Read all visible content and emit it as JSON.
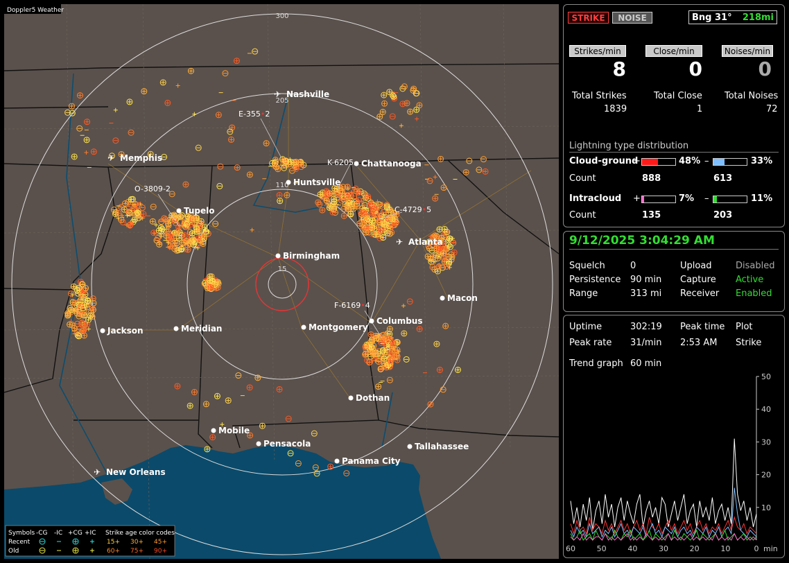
{
  "map": {
    "title": "Doppler5 Weather",
    "range_labels": [
      "300",
      "205",
      "110",
      "15"
    ],
    "cities": [
      {
        "name": "Nashville",
        "airport": true
      },
      {
        "name": "Memphis",
        "airport": true
      },
      {
        "name": "Chattanooga",
        "airport": false
      },
      {
        "name": "Huntsville",
        "airport": false
      },
      {
        "name": "Tupelo",
        "airport": false
      },
      {
        "name": "Atlanta",
        "airport": true
      },
      {
        "name": "Birmingham",
        "airport": false
      },
      {
        "name": "Macon",
        "airport": false
      },
      {
        "name": "Columbus",
        "airport": false
      },
      {
        "name": "Montgomery",
        "airport": false
      },
      {
        "name": "Meridian",
        "airport": false
      },
      {
        "name": "Jackson",
        "airport": false
      },
      {
        "name": "Dothan",
        "airport": false
      },
      {
        "name": "Mobile",
        "airport": false
      },
      {
        "name": "Pensacola",
        "airport": false
      },
      {
        "name": "Tallahassee",
        "airport": false
      },
      {
        "name": "Panama City",
        "airport": false
      },
      {
        "name": "New Orleans",
        "airport": true
      }
    ],
    "cells": [
      "E-355",
      "2",
      "K-6205",
      "O-3809",
      "2",
      "C-4729",
      "5",
      "F-6169",
      "4"
    ],
    "legend": {
      "symbols_label": "Symbols",
      "headers": [
        "-CG",
        "-IC",
        "+CG",
        "+IC"
      ],
      "rows": [
        "Recent",
        "Old"
      ],
      "age_title": "Strike age color codes",
      "ages_recent": [
        "15+",
        "30+",
        "45+"
      ],
      "ages_old": [
        "60+",
        "75+",
        "90+"
      ]
    },
    "colors": {
      "water": "#0d4d6e",
      "land": "#5a514c",
      "gulf": "#0b3d5c"
    }
  },
  "status": {
    "strike_label": "STRIKE",
    "noise_label": "NOISE",
    "bearing": "Bng 31°",
    "distance": "218mi"
  },
  "rates": {
    "strikes_label": "Strikes/min",
    "close_label": "Close/min",
    "noises_label": "Noises/min",
    "strikes_value": "8",
    "close_value": "0",
    "noises_value": "0"
  },
  "totals": {
    "strikes_label": "Total Strikes",
    "close_label": "Total Close",
    "noises_label": "Total Noises",
    "strikes": "1839",
    "close": "1",
    "noises": "72"
  },
  "distribution": {
    "title": "Lightning type distribution",
    "cg_label": "Cloud-ground",
    "ic_label": "Intracloud",
    "count_label": "Count",
    "plus": "+",
    "minus": "–",
    "cg_pos_pct": "48%",
    "cg_neg_pct": "33%",
    "ic_pos_pct": "7%",
    "ic_neg_pct": "11%",
    "cg_pos_frac": 0.48,
    "cg_neg_frac": 0.33,
    "ic_pos_frac": 0.07,
    "ic_neg_frac": 0.11,
    "cg_pos_count": "888",
    "cg_neg_count": "613",
    "ic_pos_count": "135",
    "ic_neg_count": "203",
    "colors": {
      "cg_pos": "#ff1a1a",
      "cg_neg": "#7fbfff",
      "ic_pos": "#ff66cc",
      "ic_neg": "#33dd33"
    }
  },
  "settings": {
    "datetime": "9/12/2025 3:04:29 AM",
    "squelch_label": "Squelch",
    "squelch": "0",
    "persistence_label": "Persistence",
    "persistence": "90 min",
    "range_label": "Range",
    "range": "313 mi",
    "upload_label": "Upload",
    "upload": "Disabled",
    "capture_label": "Capture",
    "capture": "Active",
    "receiver_label": "Receiver",
    "receiver": "Enabled"
  },
  "stats": {
    "uptime_label": "Uptime",
    "uptime": "302:19",
    "peak_time_label": "Peak time",
    "peak_time": "2:53 AM",
    "plot_label": "Plot",
    "plot": "Strike",
    "peak_rate_label": "Peak rate",
    "peak_rate": "31/min",
    "trend_label": "Trend graph",
    "trend": "60 min"
  },
  "chart_data": {
    "type": "line",
    "xlabel": "min",
    "x_ticks": [
      "60",
      "50",
      "40",
      "30",
      "20",
      "10",
      "0"
    ],
    "y_ticks": [
      "50",
      "40",
      "30",
      "20",
      "10"
    ],
    "xlim": [
      60,
      0
    ],
    "ylim": [
      0,
      50
    ],
    "series": [
      {
        "color": "#ffffff",
        "values": [
          12,
          5,
          10,
          4,
          11,
          6,
          13,
          3,
          9,
          12,
          5,
          14,
          7,
          11,
          4,
          10,
          13,
          6,
          12,
          8,
          5,
          11,
          14,
          4,
          9,
          12,
          7,
          10,
          5,
          13,
          11,
          4,
          8,
          12,
          6,
          10,
          14,
          5,
          9,
          11,
          4,
          12,
          7,
          10,
          6,
          13,
          5,
          9,
          11,
          6,
          10,
          5,
          31,
          14,
          9,
          12,
          6,
          10,
          4,
          8
        ]
      },
      {
        "color": "#ff3333",
        "values": [
          5,
          2,
          6,
          3,
          4,
          2,
          7,
          3,
          5,
          4,
          2,
          6,
          3,
          5,
          2,
          4,
          6,
          3,
          5,
          2,
          4,
          6,
          3,
          5,
          2,
          7,
          4,
          3,
          5,
          2,
          4,
          6,
          3,
          5,
          2,
          4,
          6,
          3,
          5,
          2,
          4,
          6,
          3,
          5,
          2,
          4,
          3,
          5,
          2,
          4,
          6,
          3,
          7,
          4,
          3,
          5,
          2,
          4,
          3,
          2
        ]
      },
      {
        "color": "#7fbfff",
        "values": [
          3,
          1,
          4,
          2,
          3,
          1,
          5,
          2,
          3,
          4,
          1,
          3,
          2,
          4,
          1,
          3,
          5,
          2,
          3,
          1,
          4,
          3,
          2,
          4,
          1,
          3,
          5,
          2,
          3,
          1,
          4,
          3,
          2,
          4,
          1,
          3,
          4,
          2,
          3,
          1,
          4,
          3,
          2,
          4,
          1,
          3,
          2,
          4,
          1,
          3,
          4,
          2,
          16,
          8,
          3,
          2,
          1,
          3,
          2,
          1
        ]
      },
      {
        "color": "#33dd33",
        "values": [
          2,
          0,
          1,
          3,
          0,
          1,
          2,
          0,
          3,
          1,
          0,
          2,
          1,
          0,
          3,
          1,
          0,
          2,
          1,
          3,
          0,
          1,
          2,
          0,
          1,
          3,
          0,
          2,
          1,
          0,
          1,
          2,
          0,
          3,
          1,
          0,
          2,
          1,
          0,
          1,
          3,
          0,
          2,
          1,
          0,
          1,
          2,
          0,
          1,
          3,
          0,
          1,
          2,
          0,
          1,
          2,
          0,
          1,
          0,
          1
        ]
      },
      {
        "color": "#ff66cc",
        "values": [
          1,
          0,
          1,
          0,
          2,
          0,
          1,
          0,
          1,
          1,
          0,
          2,
          0,
          1,
          0,
          1,
          0,
          1,
          2,
          0,
          1,
          0,
          1,
          0,
          2,
          1,
          0,
          1,
          0,
          1,
          0,
          2,
          0,
          1,
          0,
          1,
          0,
          1,
          2,
          0,
          1,
          0,
          1,
          0,
          1,
          0,
          2,
          0,
          1,
          0,
          1,
          0,
          2,
          0,
          1,
          0,
          1,
          0,
          1,
          0
        ]
      }
    ]
  }
}
